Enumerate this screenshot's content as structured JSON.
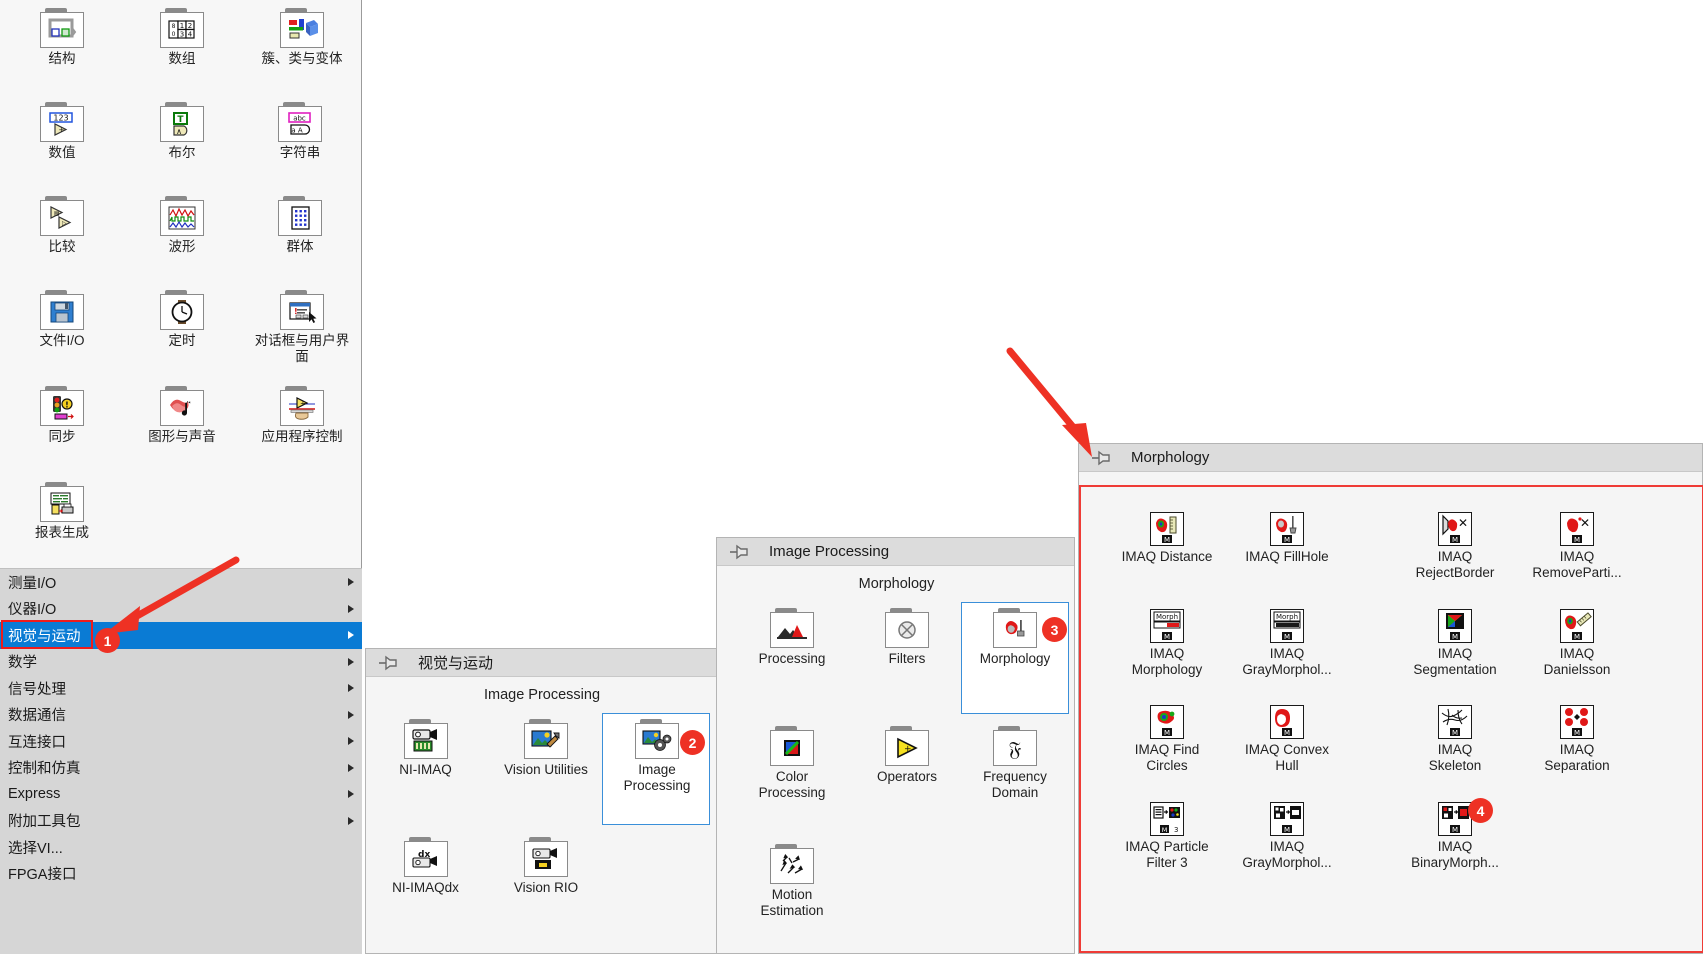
{
  "left_palette": {
    "name": "functions-palette",
    "icons": [
      {
        "label": "结构",
        "icon": "structures-icon"
      },
      {
        "label": "数组",
        "icon": "array-icon"
      },
      {
        "label": "簇、类与变体",
        "icon": "cluster-class-variant-icon"
      },
      {
        "label": "数值",
        "icon": "numeric-icon"
      },
      {
        "label": "布尔",
        "icon": "boolean-icon"
      },
      {
        "label": "字符串",
        "icon": "string-icon"
      },
      {
        "label": "比较",
        "icon": "comparison-icon"
      },
      {
        "label": "波形",
        "icon": "waveform-icon"
      },
      {
        "label": "群体",
        "icon": "collection-icon"
      },
      {
        "label": "文件I/O",
        "icon": "file-io-icon"
      },
      {
        "label": "定时",
        "icon": "timing-icon"
      },
      {
        "label": "对话框与用户界面",
        "icon": "dialog-user-interface-icon"
      },
      {
        "label": "同步",
        "icon": "synchronization-icon"
      },
      {
        "label": "图形与声音",
        "icon": "graphics-sound-icon"
      },
      {
        "label": "应用程序控制",
        "icon": "application-control-icon"
      },
      {
        "label": "报表生成",
        "icon": "report-generation-icon"
      }
    ],
    "menu_items": [
      {
        "label": "测量I/O",
        "selected": false,
        "submenu": true
      },
      {
        "label": "仪器I/O",
        "selected": false,
        "submenu": true
      },
      {
        "label": "视觉与运动",
        "selected": true,
        "submenu": true
      },
      {
        "label": "数学",
        "selected": false,
        "submenu": true
      },
      {
        "label": "信号处理",
        "selected": false,
        "submenu": true
      },
      {
        "label": "数据通信",
        "selected": false,
        "submenu": true
      },
      {
        "label": "互连接口",
        "selected": false,
        "submenu": true
      },
      {
        "label": "控制和仿真",
        "selected": false,
        "submenu": true
      },
      {
        "label": "Express",
        "selected": false,
        "submenu": true
      },
      {
        "label": "附加工具包",
        "selected": false,
        "submenu": true
      },
      {
        "label": "选择VI...",
        "selected": false,
        "submenu": false
      },
      {
        "label": "FPGA接口",
        "selected": false,
        "submenu": false
      }
    ]
  },
  "vision_motion_palette": {
    "title": "视觉与运动",
    "section_header": "Image Processing",
    "items": [
      {
        "label": "NI-IMAQ",
        "icon": "ni-imaq-folder-icon",
        "selected": false
      },
      {
        "label": "Vision Utilities",
        "icon": "vision-utilities-folder-icon",
        "selected": false
      },
      {
        "label": "Image\nProcessing",
        "icon": "image-processing-folder-icon",
        "selected": true
      },
      {
        "label": "NI-IMAQdx",
        "icon": "ni-imaqdx-folder-icon",
        "selected": false
      },
      {
        "label": "Vision RIO",
        "icon": "vision-rio-folder-icon",
        "selected": false
      }
    ]
  },
  "image_processing_palette": {
    "title": "Image Processing",
    "section_header": "Morphology",
    "items": [
      {
        "label": "Processing",
        "icon": "processing-folder-icon",
        "selected": false
      },
      {
        "label": "Filters",
        "icon": "filters-folder-icon",
        "selected": false
      },
      {
        "label": "Morphology",
        "icon": "morphology-folder-icon",
        "selected": true
      },
      {
        "label": "Color\nProcessing",
        "icon": "color-processing-folder-icon",
        "selected": false
      },
      {
        "label": "Operators",
        "icon": "operators-folder-icon",
        "selected": false
      },
      {
        "label": "Frequency\nDomain",
        "icon": "frequency-domain-folder-icon",
        "selected": false
      },
      {
        "label": "Motion\nEstimation",
        "icon": "motion-estimation-folder-icon",
        "selected": false
      }
    ]
  },
  "morphology_palette": {
    "title": "Morphology",
    "items": [
      {
        "label": "IMAQ Distance",
        "icon": "imaq-distance-vi-icon"
      },
      {
        "label": "IMAQ FillHole",
        "icon": "imaq-fillhole-vi-icon"
      },
      {
        "label": "IMAQ\nRejectBorder",
        "icon": "imaq-rejectborder-vi-icon"
      },
      {
        "label": "IMAQ\nRemoveParti...",
        "icon": "imaq-removeparticle-vi-icon"
      },
      {
        "label": "IMAQ\nMorphology",
        "icon": "imaq-morphology-vi-icon"
      },
      {
        "label": "IMAQ\nGrayMorphol...",
        "icon": "imaq-graymorphology-vi-icon"
      },
      {
        "label": "IMAQ\nSegmentation",
        "icon": "imaq-segmentation-vi-icon"
      },
      {
        "label": "IMAQ\nDanielsson",
        "icon": "imaq-danielsson-vi-icon"
      },
      {
        "label": "IMAQ Find\nCircles",
        "icon": "imaq-findcircles-vi-icon"
      },
      {
        "label": "IMAQ Convex\nHull",
        "icon": "imaq-convexhull-vi-icon"
      },
      {
        "label": "IMAQ\nSkeleton",
        "icon": "imaq-skeleton-vi-icon"
      },
      {
        "label": "IMAQ\nSeparation",
        "icon": "imaq-separation-vi-icon"
      },
      {
        "label": "IMAQ Particle\nFilter 3",
        "icon": "imaq-particlefilter3-vi-icon"
      },
      {
        "label": "IMAQ\nGrayMorphol...",
        "icon": "imaq-graymorphology2-vi-icon"
      },
      {
        "label": "IMAQ\nBinaryMorph...",
        "icon": "imaq-binarymorphology-vi-icon"
      }
    ]
  },
  "annotations": {
    "badges": [
      {
        "number": "1",
        "target": "视觉与运动"
      },
      {
        "number": "2",
        "target": "Image Processing"
      },
      {
        "number": "3",
        "target": "Morphology"
      },
      {
        "number": "4",
        "target": "Morphology palette"
      }
    ],
    "accent_color": "#ee3124",
    "highlight_color": "#ee1c1c",
    "selection_color": "#0a7bd4"
  }
}
